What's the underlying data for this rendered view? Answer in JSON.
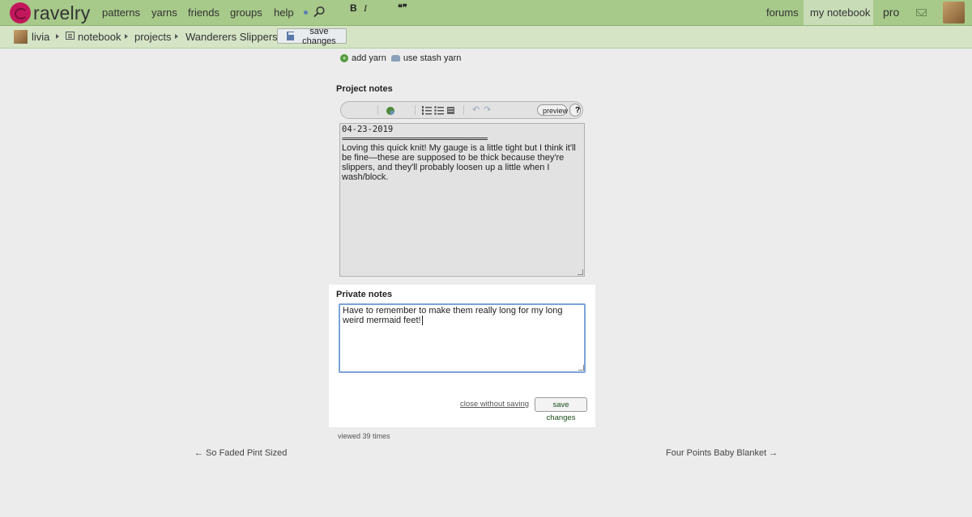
{
  "nav": {
    "logo_text": "ravelry",
    "links": [
      "patterns",
      "yarns",
      "friends",
      "groups",
      "help"
    ],
    "right_links": [
      "forums",
      "my notebook",
      "pro"
    ]
  },
  "breadcrumb": {
    "user": "livia",
    "notebook": "notebook",
    "projects": "projects",
    "project": "Wanderers Slippers",
    "save_label": "save changes"
  },
  "yarn_actions": {
    "add_yarn": "add yarn",
    "use_stash": "use stash yarn"
  },
  "project_notes": {
    "heading": "Project notes",
    "toolbar": {
      "bold": "B",
      "italic": "I",
      "quote": "❝❞",
      "preview": "preview",
      "help": "?"
    },
    "date": "04-23-2019",
    "rule": "===================================",
    "text": "Loving this quick knit! My gauge is a little tight but I think it'll be fine—these are supposed to be thick because they're slippers, and they'll probably loosen up a little when I wash/block."
  },
  "private_notes": {
    "heading": "Private notes",
    "text": "Have to remember to make them really long for my long weird mermaid feet!",
    "close_label": "close without saving",
    "save_label": "save changes"
  },
  "footer": {
    "viewed": "viewed 39 times",
    "prev": "← So Faded Pint Sized",
    "next": "Four Points Baby Blanket →"
  },
  "colors": {
    "nav_bg": "#a7c98a",
    "crumb_bg": "#d4e4c5",
    "focus_border": "#7ba3d8"
  }
}
